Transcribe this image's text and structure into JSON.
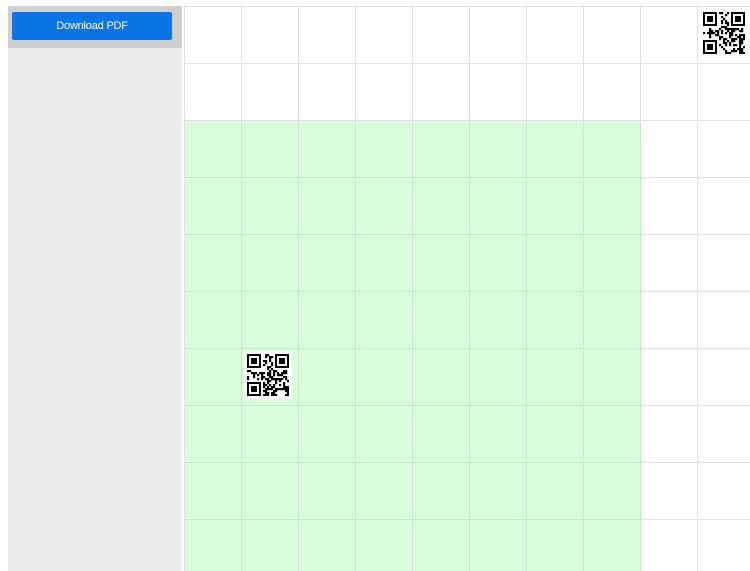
{
  "sidebar": {
    "download_button_label": "Download PDF"
  },
  "grid": {
    "columns": 10,
    "rows": 10,
    "highlight_color": "#d9fcd9",
    "highlighted_columns": [
      0,
      7
    ],
    "highlighted_rows": [
      2,
      9
    ]
  },
  "qr_codes": [
    {
      "name": "qr-code-top-right-icon",
      "col": 9,
      "row": 0
    },
    {
      "name": "qr-code-middle-icon",
      "col": 1,
      "row": 6
    }
  ],
  "colors": {
    "button": "#0a74e4",
    "sidebar": "#ececec"
  }
}
